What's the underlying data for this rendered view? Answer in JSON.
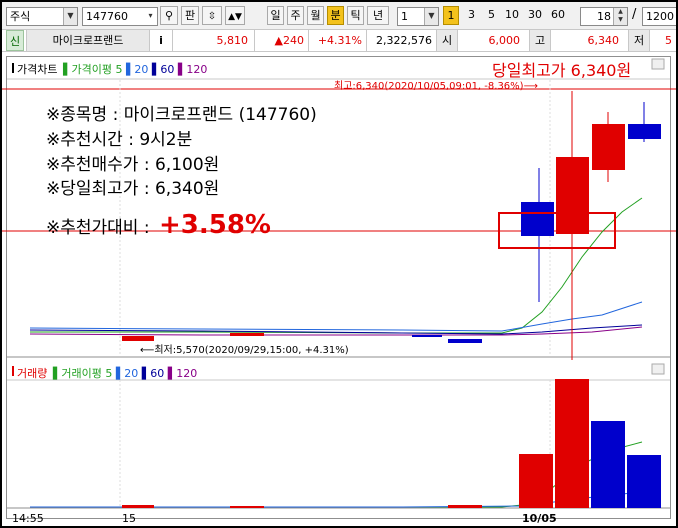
{
  "toolbar": {
    "market": "주식",
    "code": "147760",
    "ref_label": "판",
    "periods": [
      "일",
      "주",
      "월",
      "분",
      "틱",
      "년"
    ],
    "active_period": "분",
    "interval_value": "1",
    "interval_badge": "1",
    "interval_presets": [
      "3",
      "5",
      "10",
      "30",
      "60"
    ],
    "count_value": "18",
    "range_value": "1200"
  },
  "quote": {
    "tag": "신",
    "name": "마이크로프랜드",
    "info_label": "i",
    "price": "5,810",
    "change": "▲240",
    "change_pct": "+4.31%",
    "volume": "2,322,576",
    "open_label": "시",
    "open": "6,000",
    "high_label": "고",
    "high": "6,340",
    "low_label": "저",
    "low": "5"
  },
  "price_panel": {
    "legend_title": "가격차트",
    "legend_ma_label": "가격이평",
    "legend_ma_values": [
      "5",
      "20",
      "60",
      "120"
    ],
    "high_marker": "최고:6,340(2020/10/05,09:01, -8.36%)⟶",
    "low_marker": "⟵최저:5,570(2020/09/29,15:00, +4.31%)",
    "headline": "당일최고가 6,340원"
  },
  "annotation": {
    "lines": [
      "※종목명 : 마이크로프랜드 (147760)",
      "※추천시간 : 9시2분",
      "※추천매수가 : 6,100원",
      "※당일최고가 : 6,340원"
    ],
    "ratio_prefix": "※추천가대비 :",
    "ratio_value": "+3.58%"
  },
  "volume_panel": {
    "legend_title": "거래량",
    "legend_ma_label": "거래이평",
    "legend_ma_values": [
      "5",
      "20",
      "60",
      "120"
    ]
  },
  "x_axis": {
    "labels": [
      "14:55",
      "15",
      "10/05"
    ]
  },
  "colors": {
    "up": "#e00000",
    "down": "#0000cc",
    "ma5": "#22a022",
    "ma20": "#2266dd",
    "ma60": "#000099",
    "ma120": "#880088",
    "highlight": "#e00000"
  }
}
